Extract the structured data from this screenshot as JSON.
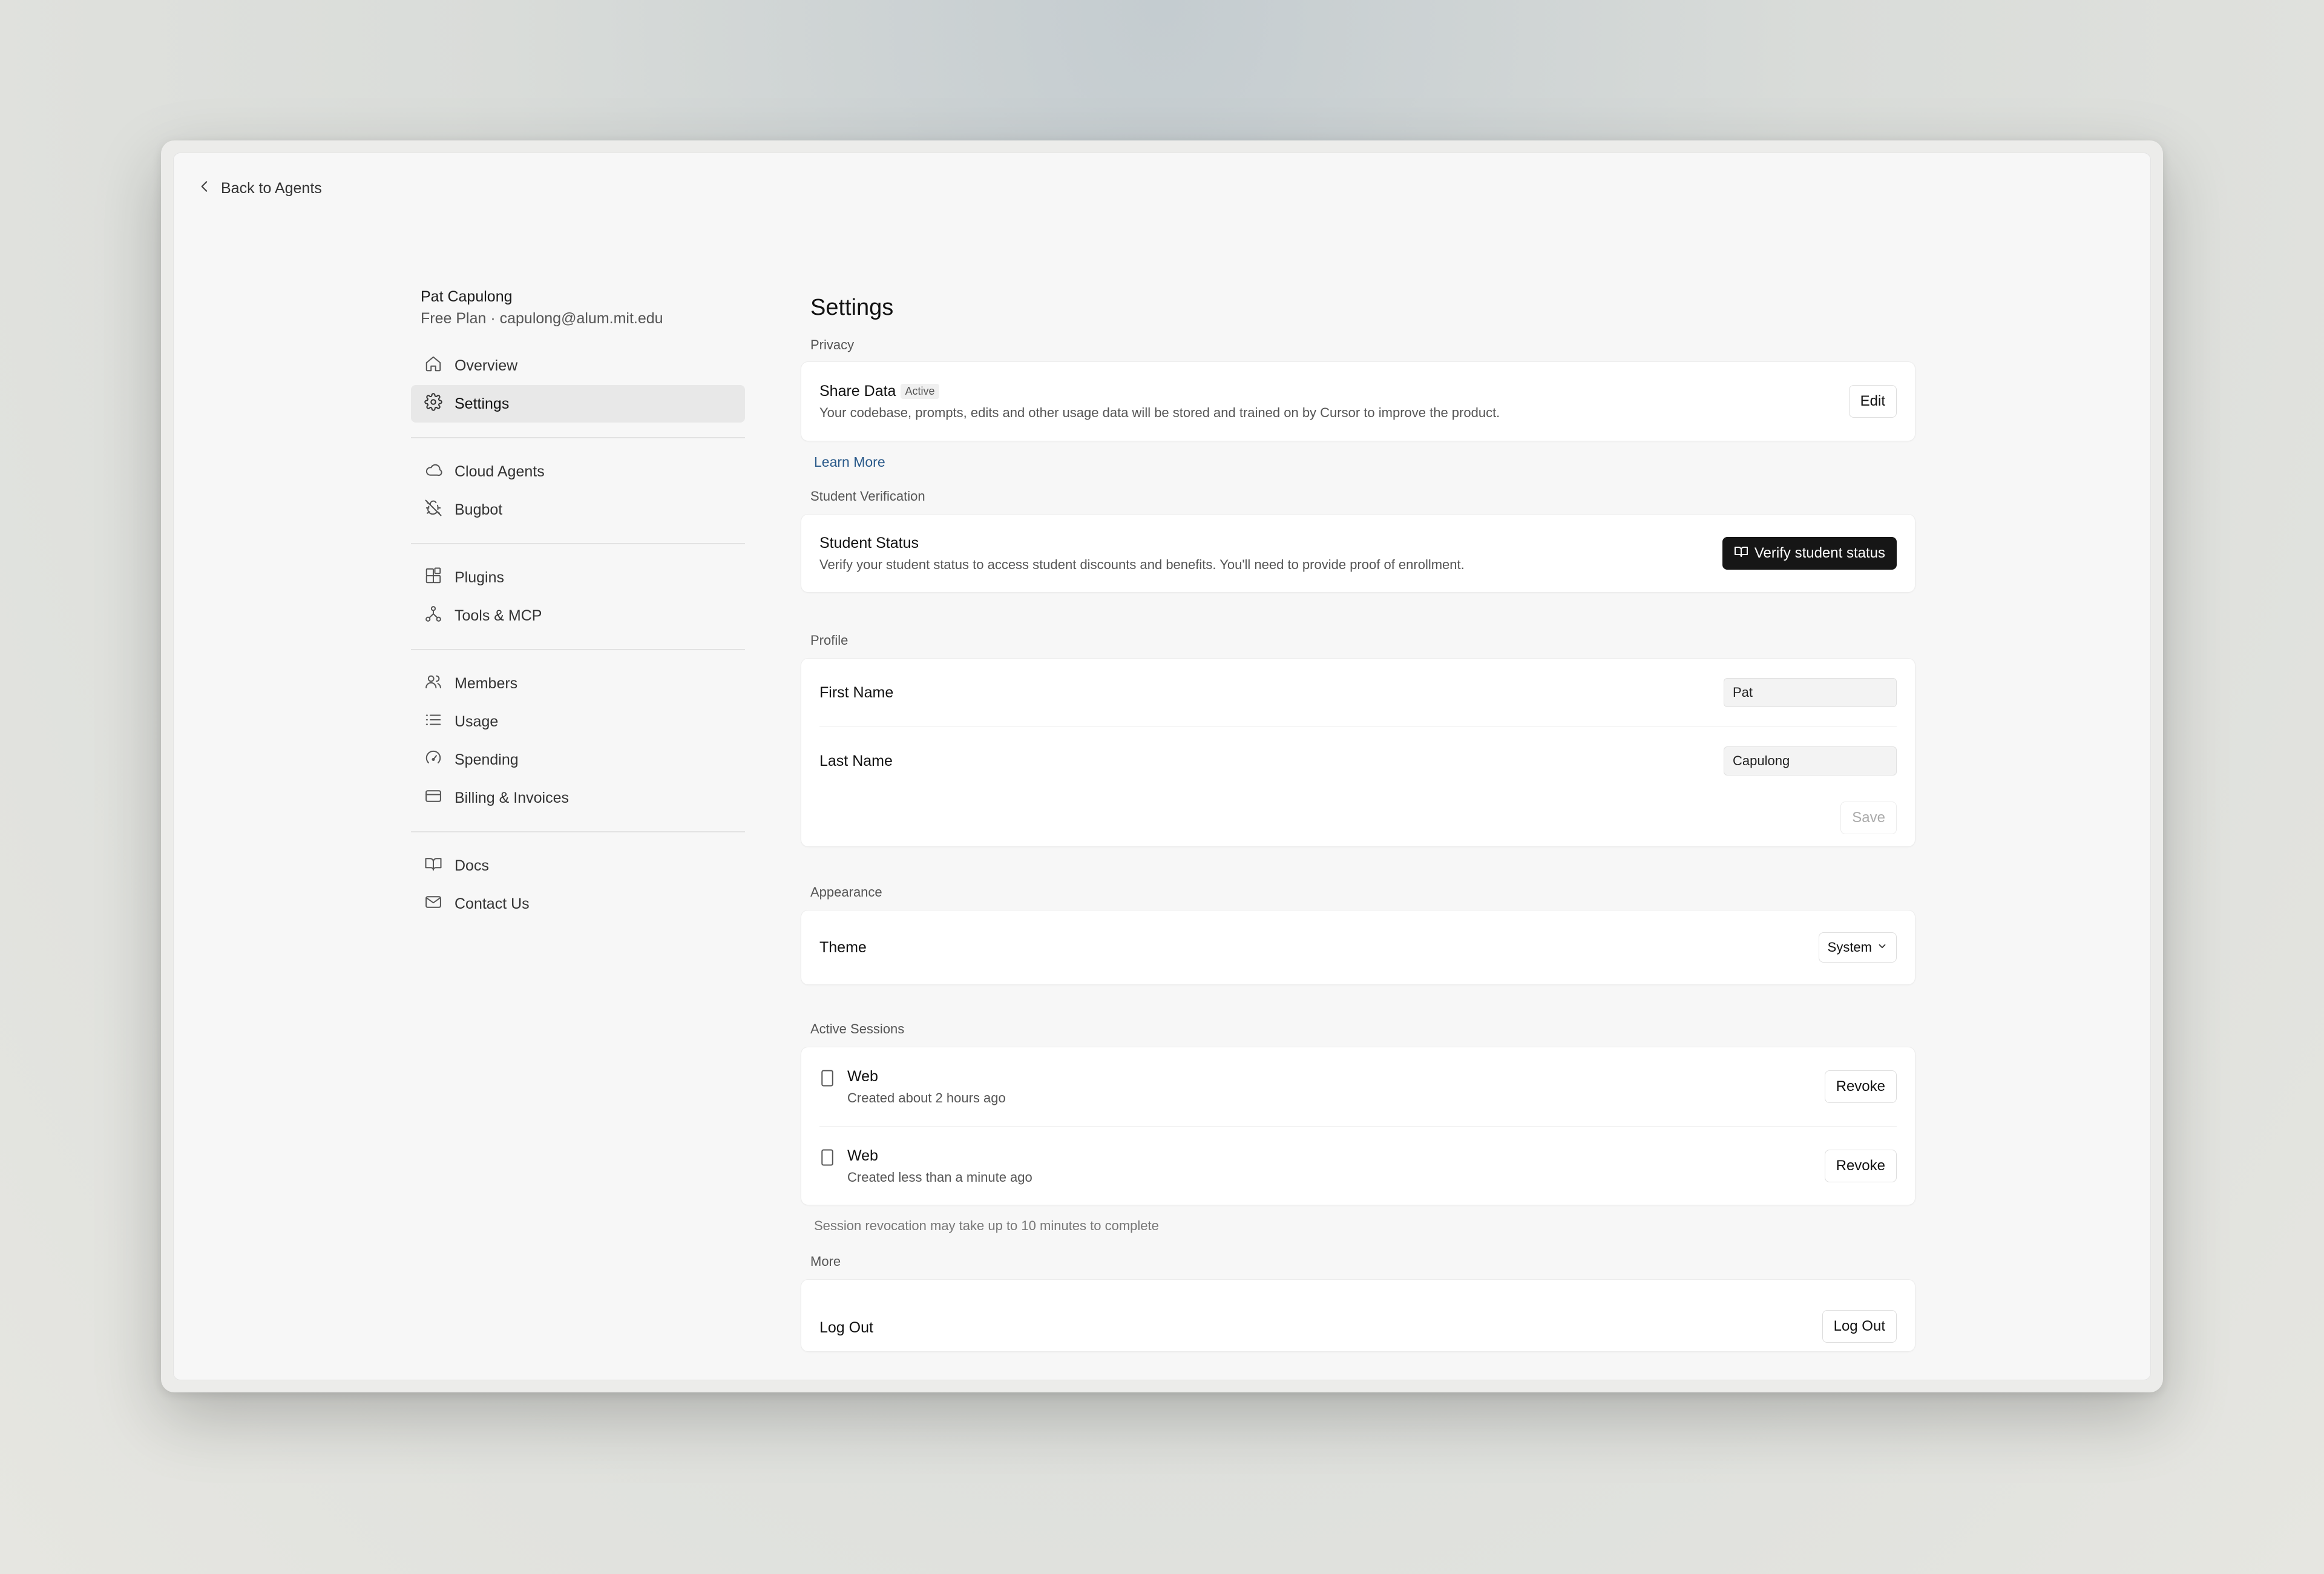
{
  "nav_back": {
    "label": "Back to Agents"
  },
  "user": {
    "name": "Pat Capulong",
    "plan_email": "Free Plan · capulong@alum.mit.edu"
  },
  "sidebar": {
    "groups": [
      [
        {
          "label": "Overview",
          "icon": "home-icon"
        },
        {
          "label": "Settings",
          "icon": "gear-icon",
          "active": true
        }
      ],
      [
        {
          "label": "Cloud Agents",
          "icon": "cloud-icon"
        },
        {
          "label": "Bugbot",
          "icon": "bug-off-icon"
        }
      ],
      [
        {
          "label": "Plugins",
          "icon": "blocks-icon"
        },
        {
          "label": "Tools & MCP",
          "icon": "network-icon"
        }
      ],
      [
        {
          "label": "Members",
          "icon": "users-icon"
        },
        {
          "label": "Usage",
          "icon": "list-icon"
        },
        {
          "label": "Spending",
          "icon": "gauge-icon"
        },
        {
          "label": "Billing & Invoices",
          "icon": "credit-card-icon"
        }
      ],
      [
        {
          "label": "Docs",
          "icon": "book-icon"
        },
        {
          "label": "Contact Us",
          "icon": "mail-icon"
        }
      ]
    ]
  },
  "main": {
    "title": "Settings",
    "privacy": {
      "label": "Privacy",
      "title": "Share Data",
      "badge": "Active",
      "desc": "Your codebase, prompts, edits and other usage data will be stored and trained on by Cursor to improve the product.",
      "edit_label": "Edit",
      "learn_more": "Learn More"
    },
    "student": {
      "label": "Student Verification",
      "title": "Student Status",
      "desc": "Verify your student status to access student discounts and benefits. You'll need to provide proof of enrollment.",
      "button": "Verify student status"
    },
    "profile": {
      "label": "Profile",
      "first_name_label": "First Name",
      "first_name_value": "Pat",
      "last_name_label": "Last Name",
      "last_name_value": "Capulong",
      "save_label": "Save"
    },
    "appearance": {
      "label": "Appearance",
      "theme_label": "Theme",
      "theme_value": "System"
    },
    "sessions": {
      "label": "Active Sessions",
      "items": [
        {
          "name": "Web",
          "created": "Created about 2 hours ago",
          "action": "Revoke"
        },
        {
          "name": "Web",
          "created": "Created less than a minute ago",
          "action": "Revoke"
        }
      ],
      "hint": "Session revocation may take up to 10 minutes to complete"
    },
    "more": {
      "label": "More",
      "logout_title": "Log Out",
      "logout_button": "Log Out"
    }
  },
  "colors": {
    "accent_link": "#2a5a8a",
    "dark_button": "#161616",
    "active_nav": "#e8e8e8"
  }
}
